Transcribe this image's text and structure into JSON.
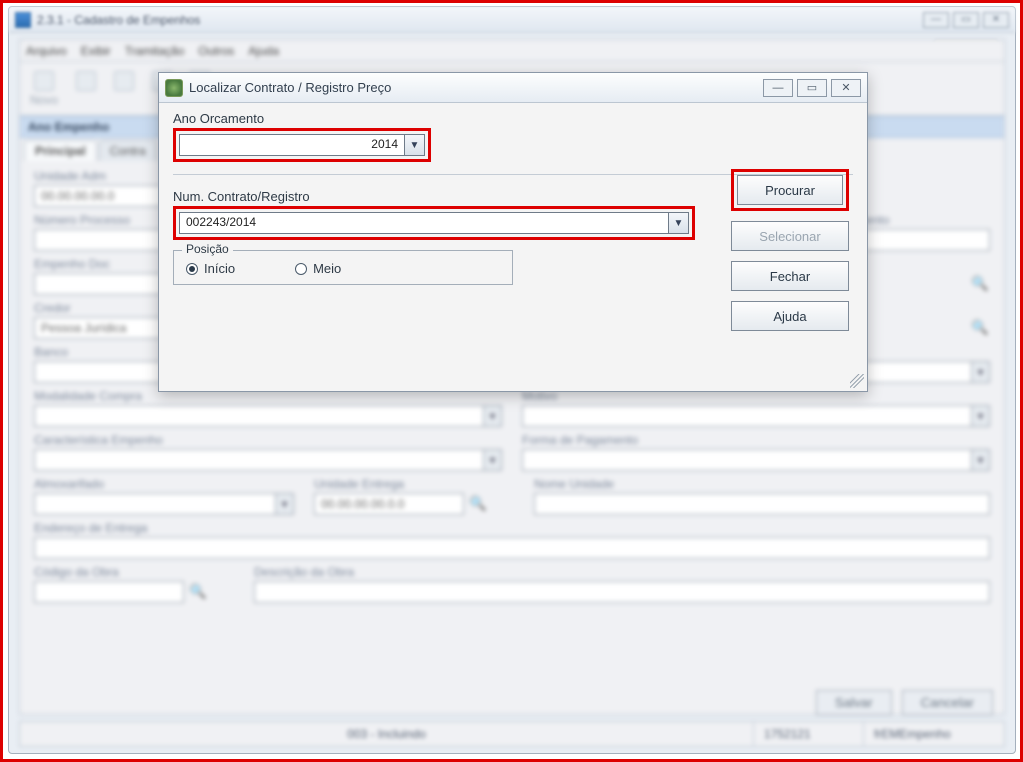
{
  "main_window": {
    "title": "2.3.1 - Cadastro de Empenhos",
    "menu": [
      "Arquivo",
      "Exibir",
      "Tramitação",
      "Outros",
      "Ajuda"
    ],
    "toolbar": {
      "novo": "Novo"
    },
    "section_header": "Ano Empenho",
    "tabs": {
      "principal": "Principal",
      "contrato": "Contra"
    },
    "fields": {
      "unidade_adm_label": "Unidade Adm",
      "unidade_adm_value": "00.00.00.00.0",
      "numero_proc_label": "Número Processo",
      "vencimento_label": "de Vencimento",
      "empenho_doc_label": "Empenho Doc",
      "credor_label": "Credor",
      "credor_value": "Pessoa Jurídica",
      "banco_label": "Banco",
      "modalidade_label": "Modalidade Compra",
      "motivo_label": "Motivo",
      "caracteristica_label": "Característica Empenho",
      "forma_pag_label": "Forma de Pagamento",
      "almoxarifado_label": "Almoxarifado",
      "unidade_entrega_label": "Unidade Entrega",
      "unidade_entrega_value": "00.00.00.00.0.0",
      "nome_unidade_label": "Nome Unidade",
      "endereco_label": "Endereço de Entrega",
      "codigo_obra_label": "Código da Obra",
      "descricao_obra_label": "Descrição da Obra"
    },
    "bottom_buttons": {
      "salvar": "Salvar",
      "cancelar": "Cancelar"
    },
    "status": {
      "center": "003 - Incluindo",
      "num": "1752121",
      "right": "frEMEmpenho"
    }
  },
  "dialog": {
    "title": "Localizar Contrato / Registro Preço",
    "ano_label": "Ano Orcamento",
    "ano_value": "2014",
    "contrato_label": "Num. Contrato/Registro",
    "contrato_value": "002243/2014",
    "posicao_legend": "Posição",
    "posicao_inicio": "Início",
    "posicao_meio": "Meio",
    "buttons": {
      "procurar": "Procurar",
      "selecionar": "Selecionar",
      "fechar": "Fechar",
      "ajuda": "Ajuda"
    }
  }
}
